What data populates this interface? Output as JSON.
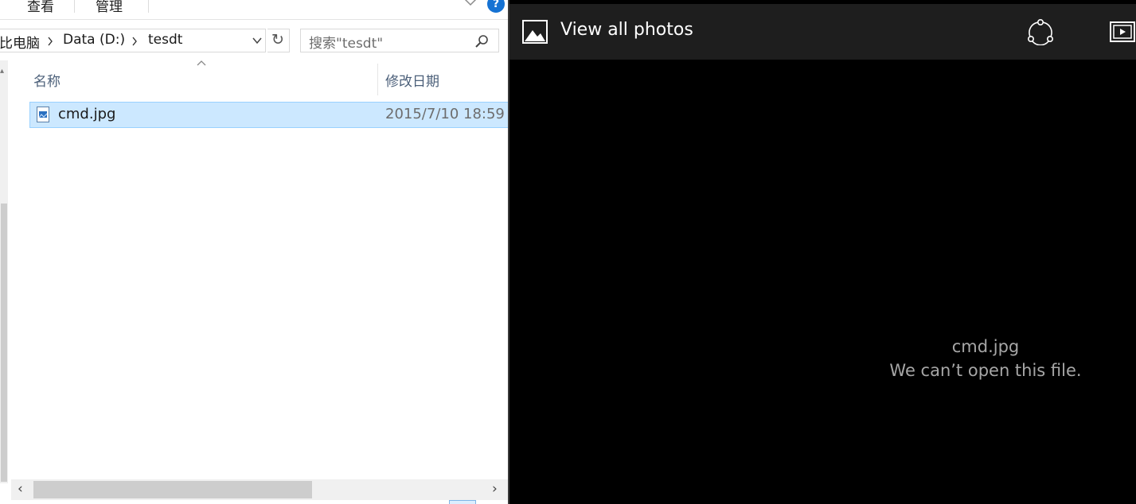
{
  "explorer": {
    "ribbon": {
      "tabs": [
        "查看",
        "管理"
      ],
      "help_label": "?"
    },
    "address": {
      "crumbs": [
        "比电脑",
        "Data (D:)",
        "tesdt"
      ]
    },
    "search": {
      "placeholder": "搜索\"tesdt\""
    },
    "columns": {
      "name": "名称",
      "modified": "修改日期"
    },
    "files": [
      {
        "name": "cmd.jpg",
        "modified": "2015/7/10 18:59",
        "selected": true,
        "icon": "image-file-icon"
      }
    ]
  },
  "photos": {
    "title": "View all photos",
    "icons": {
      "gallery": "gallery-icon",
      "share": "share-icon",
      "slideshow": "slideshow-icon"
    },
    "error": {
      "file_name": "cmd.jpg",
      "message": "We can’t open this file."
    }
  },
  "colors": {
    "selection_bg": "#cce8ff",
    "selection_border": "#99d1ff",
    "photos_bar": "#1e1e1e",
    "photos_bg": "#000000",
    "help_blue": "#1572d3"
  }
}
